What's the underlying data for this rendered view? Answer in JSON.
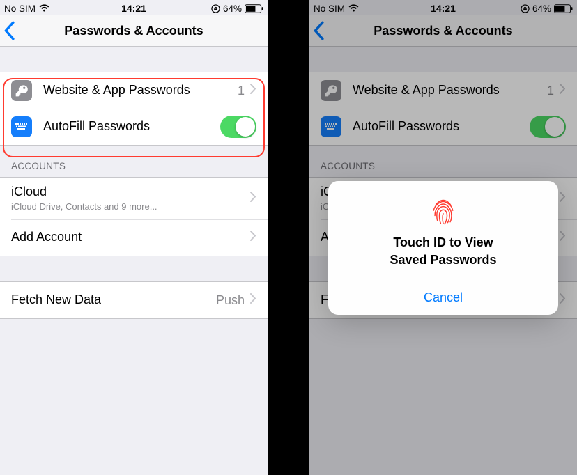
{
  "status": {
    "carrier": "No SIM",
    "time": "14:21",
    "battery_pct": "64%"
  },
  "nav": {
    "title": "Passwords & Accounts"
  },
  "rows": {
    "passwords_label": "Website & App Passwords",
    "passwords_count": "1",
    "autofill_label": "AutoFill Passwords"
  },
  "accounts_header": "ACCOUNTS",
  "icloud": {
    "title": "iCloud",
    "subtitle": "iCloud Drive, Contacts and 9 more..."
  },
  "add_account": "Add Account",
  "fetch": {
    "label": "Fetch New Data",
    "value": "Push"
  },
  "alert": {
    "title_line1": "Touch ID to View",
    "title_line2": "Saved Passwords",
    "cancel": "Cancel"
  }
}
